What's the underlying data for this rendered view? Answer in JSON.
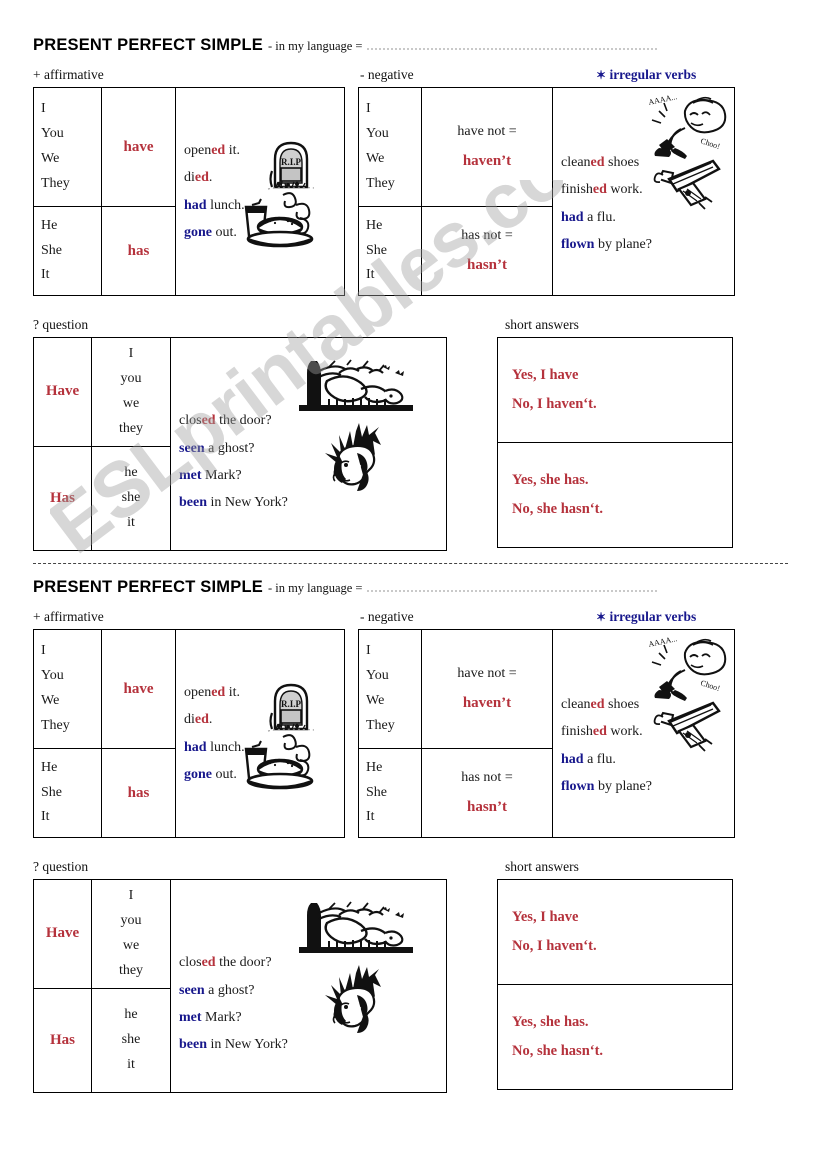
{
  "worksheet": {
    "title_main": "PRESENT PERFECT SIMPLE",
    "title_sub": "- in my language =",
    "label_affirmative": "+  affirmative",
    "label_negative": "-  negative",
    "label_irregular": "irregular verbs",
    "star_glyph": "✶",
    "label_question": "?  question",
    "label_short_answers": "short answers"
  },
  "affirmative": {
    "row1": {
      "pronouns": [
        "I",
        "You",
        "We",
        "They"
      ],
      "aux": "have"
    },
    "row2": {
      "pronouns": [
        "He",
        "She",
        "It"
      ],
      "aux": "has"
    },
    "examples": [
      {
        "pre": "open",
        "mid": "ed",
        "post": " it.",
        "style": "regular"
      },
      {
        "pre": "di",
        "mid": "ed",
        "post": ".",
        "style": "regular"
      },
      {
        "pre": "",
        "mid": "had",
        "post": " lunch.",
        "style": "irregular"
      },
      {
        "pre": "",
        "mid": "gone",
        "post": " out.",
        "style": "irregular"
      }
    ]
  },
  "negative": {
    "row1": {
      "pronouns": [
        "I",
        "You",
        "We",
        "They"
      ],
      "aux_full": "have not =",
      "aux_short": "haven’t"
    },
    "row2": {
      "pronouns": [
        "He",
        "She",
        "It"
      ],
      "aux_full": "has not =",
      "aux_short": "hasn’t"
    },
    "examples": [
      {
        "pre": "clean",
        "mid": "ed",
        "post": " shoes",
        "style": "regular"
      },
      {
        "pre": "finish",
        "mid": "ed",
        "post": " work.",
        "style": "regular"
      },
      {
        "pre": "",
        "mid": "had",
        "post": " a flu.",
        "style": "irregular"
      },
      {
        "pre": "",
        "mid": "flown",
        "post": " by plane?",
        "style": "irregular"
      }
    ]
  },
  "question": {
    "row1": {
      "aux": "Have",
      "pronouns": [
        "I",
        "you",
        "we",
        "they"
      ]
    },
    "row2": {
      "aux": "Has",
      "pronouns": [
        "he",
        "she",
        "it"
      ]
    },
    "examples": [
      {
        "pre": "clos",
        "mid": "ed",
        "post": " the door?",
        "style": "regular"
      },
      {
        "pre": "",
        "mid": "seen",
        "post": " a ghost?",
        "style": "irregular"
      },
      {
        "pre": "",
        "mid": "met",
        "post": " Mark?",
        "style": "irregular"
      },
      {
        "pre": "",
        "mid": "been",
        "post": " in New York?",
        "style": "irregular"
      }
    ]
  },
  "short_answers": {
    "block1": [
      "Yes, I have",
      "No, I haven‘t."
    ],
    "block2": [
      "Yes, she has.",
      "No, she hasn‘t."
    ]
  },
  "clipart": {
    "tombstone_text": "R.I.P",
    "sneeze_text_1": "AAAA...",
    "sneeze_text_2": "Choo!"
  },
  "watermark": {
    "text": "ESLprintables.com"
  },
  "colors": {
    "red": "#b5323c",
    "blue": "#17178c",
    "ink": "#1a1a1a"
  }
}
